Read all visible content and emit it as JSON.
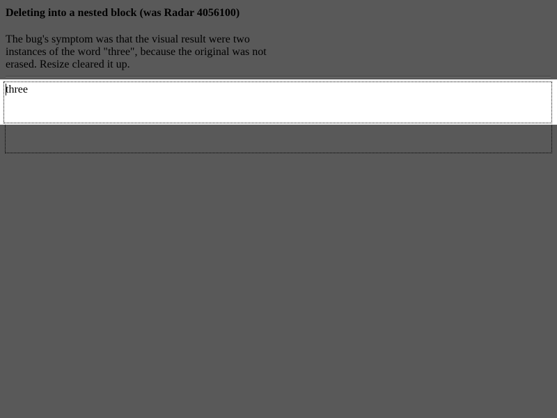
{
  "page": {
    "heading": "Deleting into a nested block (was Radar 4056100)",
    "description": "The bug's symptom was that the visual result were two instances of the word \"three\", because the original was not erased. Resize cleared it up."
  },
  "editor": {
    "content": "three"
  }
}
